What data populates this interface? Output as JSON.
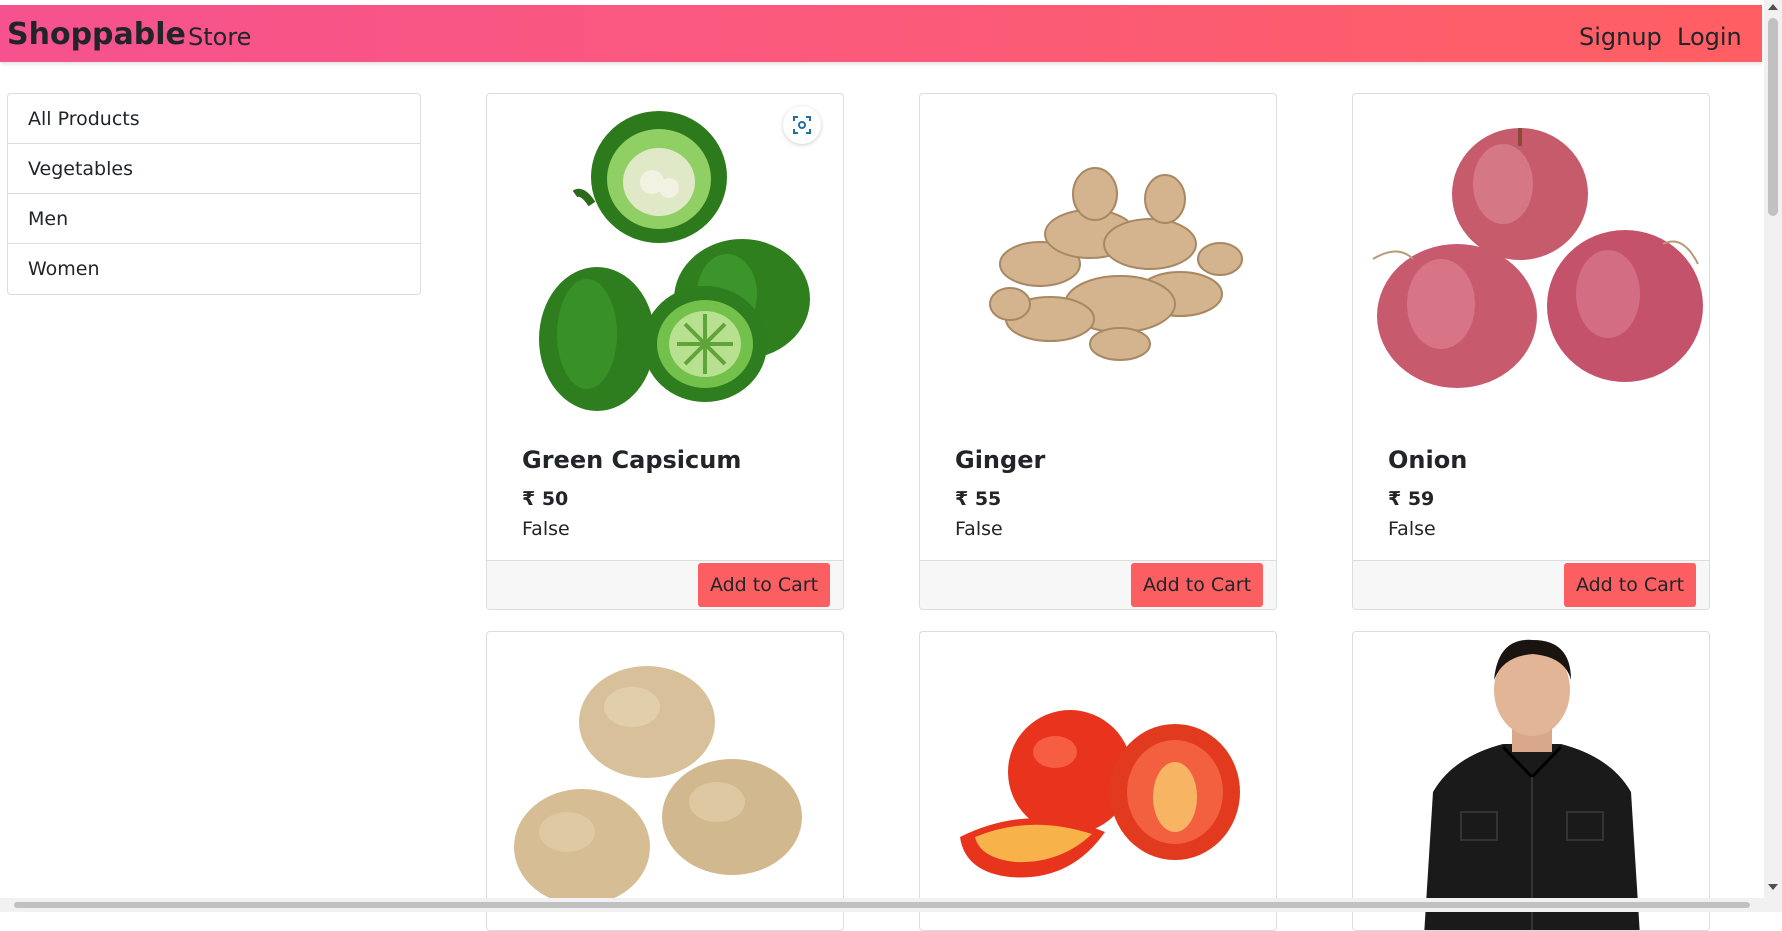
{
  "navbar": {
    "brand": "Shoppable",
    "store": "Store",
    "signup": "Signup",
    "login": "Login",
    "gradient": [
      "#f5528f",
      "#ff5f62"
    ]
  },
  "sidebar": {
    "items": [
      {
        "label": "All Products"
      },
      {
        "label": "Vegetables"
      },
      {
        "label": "Men"
      },
      {
        "label": "Women"
      }
    ]
  },
  "products": [
    {
      "name": "Green Capsicum",
      "price": "₹ 50",
      "status": "False",
      "button": "Add to Cart",
      "image": "green-capsicum"
    },
    {
      "name": "Ginger",
      "price": "₹ 55",
      "status": "False",
      "button": "Add to Cart",
      "image": "ginger"
    },
    {
      "name": "Onion",
      "price": "₹ 59",
      "status": "False",
      "button": "Add to Cart",
      "image": "onion"
    },
    {
      "name": "",
      "price": "",
      "status": "",
      "button": "",
      "image": "potato"
    },
    {
      "name": "",
      "price": "",
      "status": "",
      "button": "",
      "image": "tomato"
    },
    {
      "name": "",
      "price": "",
      "status": "",
      "button": "",
      "image": "man-black-shirt"
    }
  ],
  "colors": {
    "accent_button": "#fb5f62",
    "card_footer": "#f7f7f7"
  },
  "icons": {
    "image_scan": "scan-icon"
  }
}
